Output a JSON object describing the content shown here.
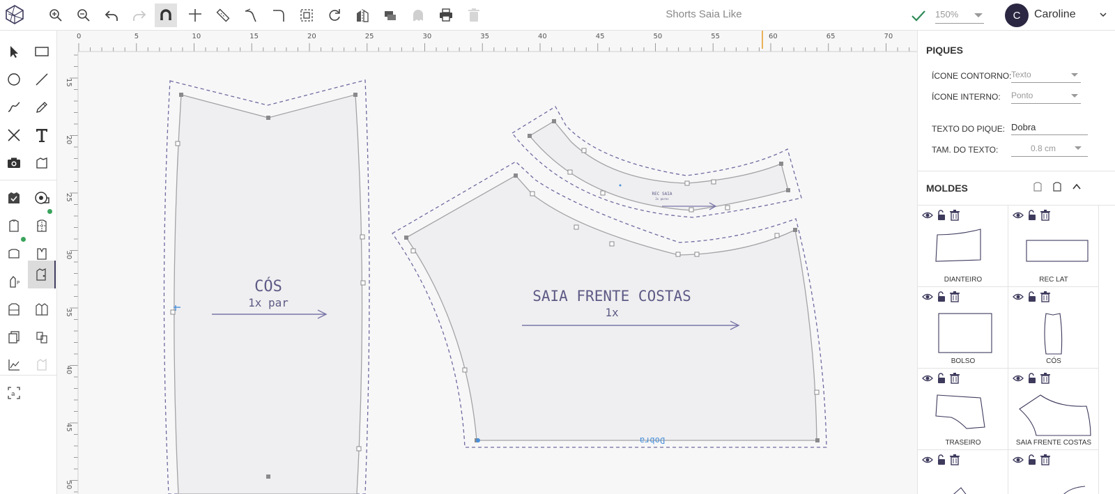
{
  "app": {
    "title": "Shorts Saia Like"
  },
  "toolbar": {
    "icons": [
      "zoom-in-icon",
      "zoom-out-icon",
      "undo-icon",
      "redo-icon",
      "magnet-icon",
      "crosshair-icon",
      "ruler-icon",
      "curve-tool-icon",
      "corner-tool-icon",
      "select-frame-icon",
      "rotate-icon",
      "mirror-icon",
      "layers-icon",
      "ghost-icon",
      "print-icon",
      "trash-icon"
    ],
    "zoom_value": "150%"
  },
  "user": {
    "initial": "C",
    "name": "Caroline"
  },
  "ruler": {
    "x_ticks": [
      "0",
      "5",
      "10",
      "15",
      "20",
      "25",
      "30",
      "35",
      "40",
      "45",
      "50",
      "55",
      "60",
      "65",
      "70"
    ],
    "y_ticks": [
      "15",
      "20",
      "25",
      "30",
      "35",
      "40",
      "45",
      "50"
    ]
  },
  "pieces": {
    "cos": {
      "name": "CÓS",
      "qty": "1x par"
    },
    "saia": {
      "name": "SAIA FRENTE COSTAS",
      "qty": "1x",
      "fold_label": "Dobra"
    },
    "rec_saia": {
      "name": "REC SAIA",
      "qty": "2x pares"
    }
  },
  "piques": {
    "title": "PIQUES",
    "contorno_label": "ÍCONE CONTORNO:",
    "contorno_value": "Texto",
    "interno_label": "ÍCONE INTERNO:",
    "interno_value": "Ponto",
    "texto_label": "TEXTO DO PIQUE:",
    "texto_value": "Dobra",
    "tam_label": "TAM. DO TEXTO:",
    "tam_value": "0.8 cm"
  },
  "moldes": {
    "title": "MOLDES",
    "items": [
      {
        "label": "DIANTEIRO"
      },
      {
        "label": "REC LAT"
      },
      {
        "label": "BOLSO"
      },
      {
        "label": "CÓS"
      },
      {
        "label": "TRASEIRO"
      },
      {
        "label": "SAIA FRENTE COSTAS"
      }
    ]
  },
  "colors": {
    "accent": "#3d3a5c",
    "piece_fill": "#efeff1",
    "dash": "#6f6a9e",
    "label": "#5d5a85"
  }
}
